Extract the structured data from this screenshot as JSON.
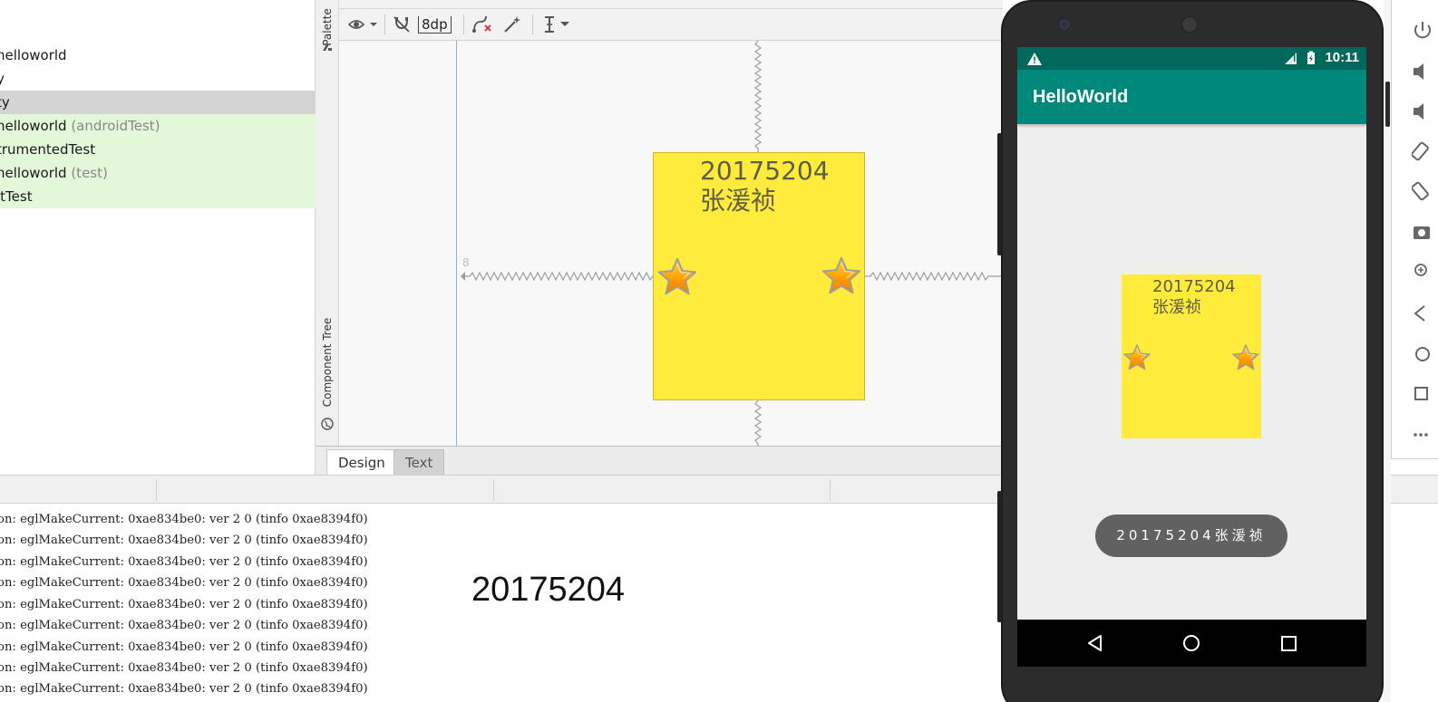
{
  "project_tree": {
    "rows": [
      {
        "text": "helloworld",
        "suffix": "",
        "state": "normal"
      },
      {
        "text": "y",
        "suffix": "",
        "state": "normal"
      },
      {
        "text": "ty",
        "suffix": "",
        "state": "selected"
      },
      {
        "text": "helloworld",
        "suffix": " (androidTest)",
        "state": "test"
      },
      {
        "text": "trumentedTest",
        "suffix": "",
        "state": "test"
      },
      {
        "text": "helloworld",
        "suffix": " (test)",
        "state": "test"
      },
      {
        "text": "itTest",
        "suffix": "",
        "state": "test"
      }
    ]
  },
  "side_tabs": {
    "palette": "Palette",
    "component_tree": "Component Tree"
  },
  "toolbar": {
    "margin_value": "8dp"
  },
  "design_canvas": {
    "widget_text": "20175204\n张湲祯",
    "margin_label": "8"
  },
  "editor_tabs": [
    {
      "label": "Design",
      "active": true
    },
    {
      "label": "Text",
      "active": false
    }
  ],
  "logcat": {
    "line_text": "on: eglMakeCurrent: 0xae834be0: ver 2 0 (tinfo 0xae8394f0)",
    "line_count": 9,
    "overlay_text": "20175204"
  },
  "device": {
    "status_time": "10:11",
    "app_title": "HelloWorld",
    "widget_text": "20175204\n张湲祯",
    "toast_text": "20175204张湲祯"
  },
  "colors": {
    "status_bar": "#00695c",
    "app_bar": "#00897b",
    "widget_yellow": "#ffeb3b",
    "tree_selected": "#d4d4d4",
    "tree_test": "#e3f7d9"
  }
}
